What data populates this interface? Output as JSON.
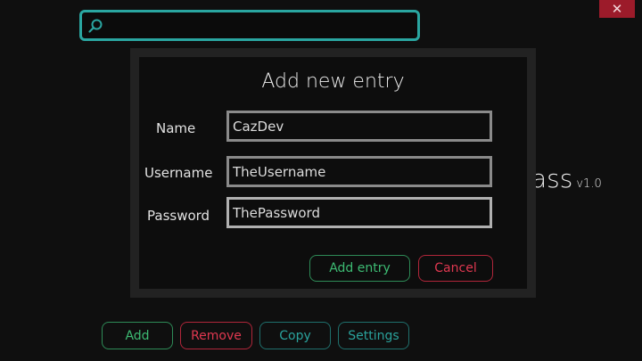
{
  "window": {
    "close_label": "✕"
  },
  "search": {
    "value": "",
    "placeholder": "",
    "icon": "search-icon"
  },
  "background": {
    "title_fragment": "ass",
    "version": "v1.0"
  },
  "dialog": {
    "title": "Add new entry",
    "fields": {
      "name": {
        "label": "Name",
        "value": "CazDev"
      },
      "username": {
        "label": "Username",
        "value": "TheUsername"
      },
      "password": {
        "label": "Password",
        "value": "ThePassword"
      }
    },
    "add_label": "Add entry",
    "cancel_label": "Cancel"
  },
  "toolbar": {
    "add_label": "Add",
    "remove_label": "Remove",
    "copy_label": "Copy",
    "settings_label": "Settings"
  },
  "colors": {
    "accent_teal": "#2aa6a1",
    "green": "#3dbb73",
    "red": "#df3850",
    "close_bg": "#9c1b2a"
  }
}
